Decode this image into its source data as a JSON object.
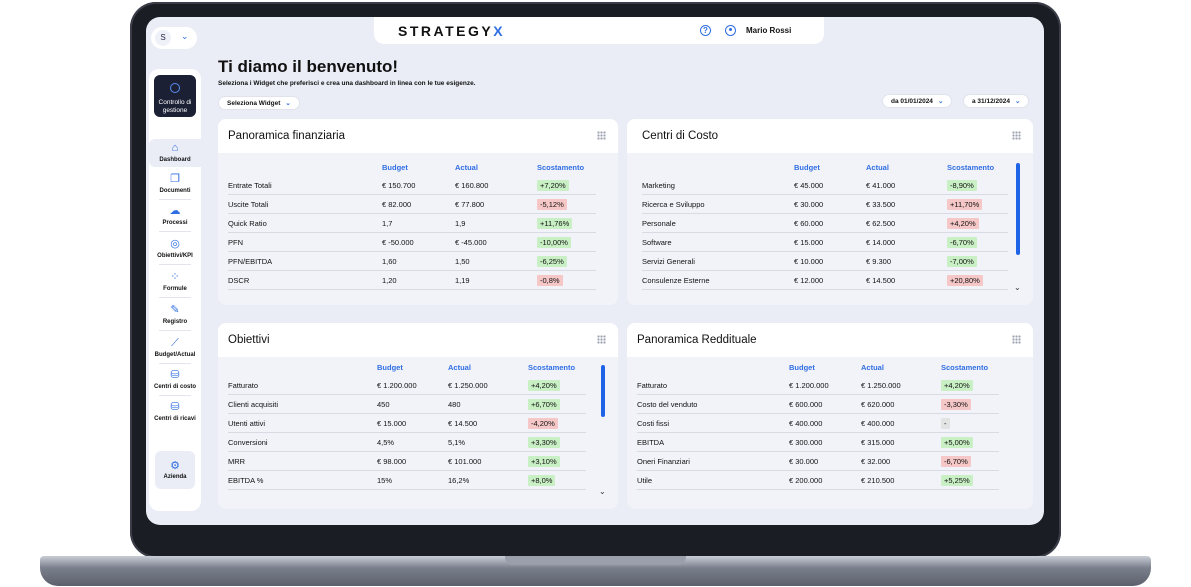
{
  "app": {
    "brand_prefix": "STRATEGY",
    "brand_suffix": "X",
    "logo_text": "S",
    "help_glyph": "?",
    "user_name": "Mario Rossi"
  },
  "sidebar": {
    "control_label": "Controllo di gestione",
    "items": [
      {
        "label": "Dashboard",
        "icon": "home-icon"
      },
      {
        "label": "Documenti",
        "icon": "documents-icon"
      },
      {
        "label": "Processi",
        "icon": "process-icon"
      },
      {
        "label": "Obiettivi/KPI",
        "icon": "target-icon"
      },
      {
        "label": "Formule",
        "icon": "formula-icon"
      },
      {
        "label": "Registro",
        "icon": "edit-icon"
      },
      {
        "label": "Budget/Actual",
        "icon": "chart-line-icon"
      },
      {
        "label": "Centri di costo",
        "icon": "database-icon"
      },
      {
        "label": "Centri di ricavi",
        "icon": "database-icon"
      }
    ],
    "bottom_label": "Azienda"
  },
  "header": {
    "title": "Ti diamo il benvenuto!",
    "subtitle": "Seleziona i Widget che preferisci e crea una dashboard in linea con le tue esigenze.",
    "widget_select": "Seleziona Widget",
    "date_from": "da 01/01/2024",
    "date_to": "a 31/12/2024"
  },
  "cards": {
    "fin": {
      "title": "Panoramica finanziaria",
      "headers": [
        "Budget",
        "Actual",
        "Scostamento"
      ],
      "rows": [
        {
          "label": "Entrate Totali",
          "budget": "€ 150.700",
          "actual": "€ 160.800",
          "delta": "+7,20%",
          "tone": "pos"
        },
        {
          "label": "Uscite Totali",
          "budget": "€ 82.000",
          "actual": "€ 77.800",
          "delta": "-5,12%",
          "tone": "neg"
        },
        {
          "label": "Quick Ratio",
          "budget": "1,7",
          "actual": "1,9",
          "delta": "+11,76%",
          "tone": "pos"
        },
        {
          "label": "PFN",
          "budget": "€ -50.000",
          "actual": "€ -45.000",
          "delta": "-10,00%",
          "tone": "pos"
        },
        {
          "label": "PFN/EBITDA",
          "budget": "1,60",
          "actual": "1,50",
          "delta": "-6,25%",
          "tone": "pos"
        },
        {
          "label": "DSCR",
          "budget": "1,20",
          "actual": "1,19",
          "delta": "-0,8%",
          "tone": "neg"
        }
      ]
    },
    "costi": {
      "title": "Centri di Costo",
      "headers": [
        "Budget",
        "Actual",
        "Scostamento"
      ],
      "rows": [
        {
          "label": "Marketing",
          "budget": "€ 45.000",
          "actual": "€ 41.000",
          "delta": "-8,90%",
          "tone": "pos"
        },
        {
          "label": "Ricerca e Sviluppo",
          "budget": "€ 30.000",
          "actual": "€ 33.500",
          "delta": "+11,70%",
          "tone": "neg"
        },
        {
          "label": "Personale",
          "budget": "€ 60.000",
          "actual": "€ 62.500",
          "delta": "+4,20%",
          "tone": "neg"
        },
        {
          "label": "Software",
          "budget": "€ 15.000",
          "actual": "€ 14.000",
          "delta": "-6,70%",
          "tone": "pos"
        },
        {
          "label": "Servizi Generali",
          "budget": "€ 10.000",
          "actual": "€ 9.300",
          "delta": "-7,00%",
          "tone": "pos"
        },
        {
          "label": "Consulenze Esterne",
          "budget": "€ 12.000",
          "actual": "€ 14.500",
          "delta": "+20,80%",
          "tone": "neg"
        }
      ]
    },
    "obiettivi": {
      "title": "Obiettivi",
      "headers": [
        "Budget",
        "Actual",
        "Scostamento"
      ],
      "rows": [
        {
          "label": "Fatturato",
          "budget": "€ 1.200.000",
          "actual": "€ 1.250.000",
          "delta": "+4,20%",
          "tone": "pos"
        },
        {
          "label": "Clienti acquisiti",
          "budget": "450",
          "actual": "480",
          "delta": "+6,70%",
          "tone": "pos"
        },
        {
          "label": "Utenti attivi",
          "budget": "€ 15.000",
          "actual": "€ 14.500",
          "delta": "-4,20%",
          "tone": "neg"
        },
        {
          "label": "Conversioni",
          "budget": "4,5%",
          "actual": "5,1%",
          "delta": "+3,30%",
          "tone": "pos"
        },
        {
          "label": "MRR",
          "budget": "€ 98.000",
          "actual": "€ 101.000",
          "delta": "+3,10%",
          "tone": "pos"
        },
        {
          "label": "EBITDA %",
          "budget": "15%",
          "actual": "16,2%",
          "delta": "+8,0%",
          "tone": "pos"
        }
      ]
    },
    "reddito": {
      "title": "Panoramica Reddituale",
      "headers": [
        "Budget",
        "Actual",
        "Scostamento"
      ],
      "rows": [
        {
          "label": "Fatturato",
          "budget": "€ 1.200.000",
          "actual": "€ 1.250.000",
          "delta": "+4,20%",
          "tone": "pos"
        },
        {
          "label": "Costo del venduto",
          "budget": "€ 600.000",
          "actual": "€ 620.000",
          "delta": "-3,30%",
          "tone": "neg"
        },
        {
          "label": "Costi fissi",
          "budget": "€ 400.000",
          "actual": "€ 400.000",
          "delta": "-",
          "tone": "neu"
        },
        {
          "label": "EBITDA",
          "budget": "€ 300.000",
          "actual": "€ 315.000",
          "delta": "+5,00%",
          "tone": "pos"
        },
        {
          "label": "Oneri Finanziari",
          "budget": "€ 30.000",
          "actual": "€ 32.000",
          "delta": "-6,70%",
          "tone": "neg"
        },
        {
          "label": "Utile",
          "budget": "€ 200.000",
          "actual": "€ 210.500",
          "delta": "+5,25%",
          "tone": "pos"
        }
      ]
    }
  }
}
